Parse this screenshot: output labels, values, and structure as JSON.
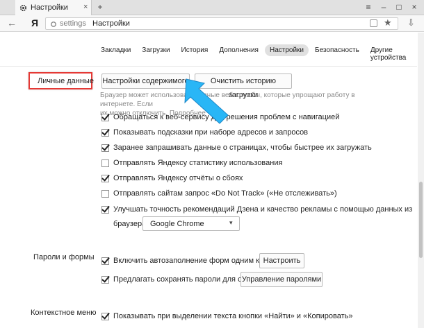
{
  "window": {
    "tab_title": "Настройки",
    "tab_close": "×",
    "new_tab": "+",
    "controls": {
      "menu": "≡",
      "minimize": "–",
      "maximize": "□",
      "close": "×"
    }
  },
  "address_bar": {
    "back": "←",
    "logo": "Я",
    "host": "settings",
    "page": "Настройки",
    "star": "★",
    "menu": "⇩"
  },
  "settings_tabs": [
    {
      "label": "Закладки",
      "active": false
    },
    {
      "label": "Загрузки",
      "active": false
    },
    {
      "label": "История",
      "active": false
    },
    {
      "label": "Дополнения",
      "active": false
    },
    {
      "label": "Настройки",
      "active": true
    },
    {
      "label": "Безопасность",
      "active": false
    },
    {
      "label": "Другие устройства",
      "active": false
    }
  ],
  "personal": {
    "label": "Личные данные",
    "content_settings_button": "Настройки содержимого",
    "clear_history_button": "Очистить историю загрузки",
    "description_line1": "Браузер может использовать разные веб-службы, которые упрощают работу в интернете. Если",
    "description_line2": "их можно отключить. Подробнее",
    "options": [
      {
        "label": "Обращаться к веб-сервису для решения проблем с навигацией",
        "checked": true
      },
      {
        "label": "Показывать подсказки при наборе адресов и запросов",
        "checked": true
      },
      {
        "label": "Заранее запрашивать данные о страницах, чтобы быстрее их загружать",
        "checked": true
      },
      {
        "label": "Отправлять Яндексу статистику использования",
        "checked": false
      },
      {
        "label": "Отправлять Яндексу отчёты о сбоях",
        "checked": true
      },
      {
        "label": "Отправлять сайтам запрос «Do Not Track» («Не отслеживать»)",
        "checked": false
      },
      {
        "label": "Улучшать точность рекомендаций Дзена и качество рекламы с помощью данных из",
        "checked": true
      }
    ],
    "browser_label": "браузера:",
    "browser_select": "Google Chrome",
    "select_arrow": "▾"
  },
  "passwords": {
    "label": "Пароли и формы",
    "options": [
      {
        "label": "Включить автозаполнение форм одним кликом",
        "checked": true,
        "button": "Настроить"
      },
      {
        "label": "Предлагать сохранять пароли для сайтов",
        "checked": true,
        "button": "Управление паролями"
      }
    ]
  },
  "context_menu": {
    "label": "Контекстное меню",
    "options": [
      {
        "label": "Показывать при выделении текста кнопки «Найти» и «Копировать»",
        "checked": true
      }
    ]
  },
  "colors": {
    "highlight_border": "#e53935",
    "arrow": "#29b6f6"
  }
}
